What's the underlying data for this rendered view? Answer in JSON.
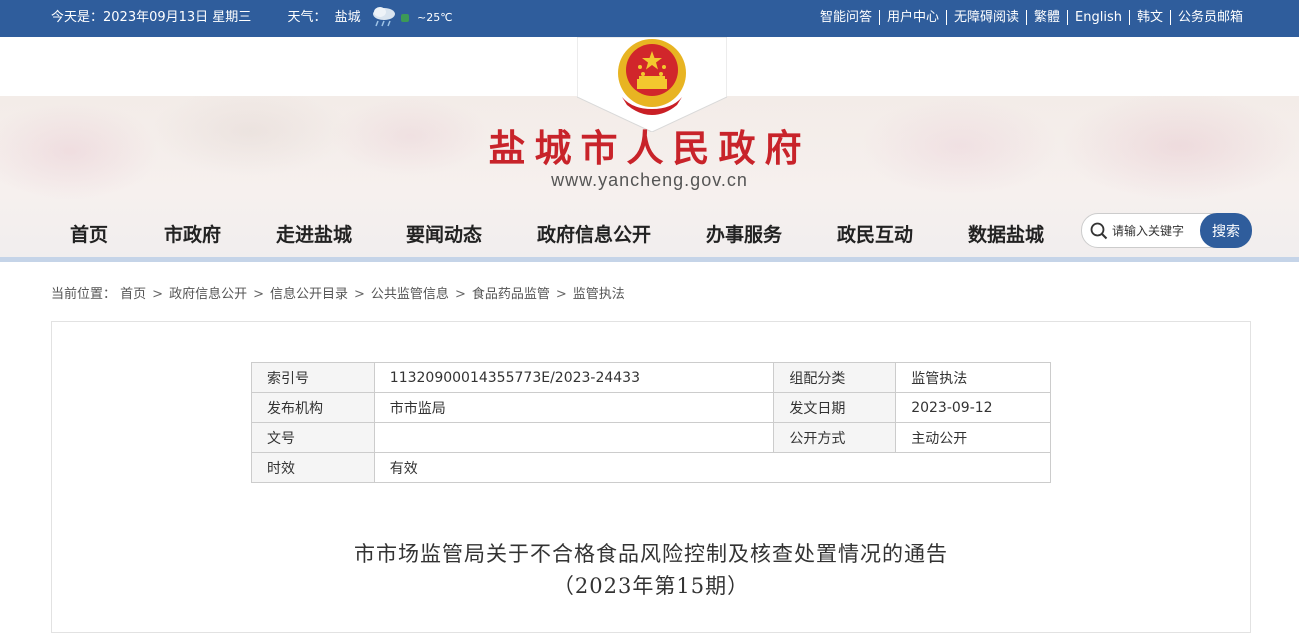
{
  "topbar": {
    "date_text": "今天是：2023年09月13日 星期三",
    "weather_label": "天气：",
    "weather_city": "盐城",
    "weather_temp": "~25℃",
    "links": [
      "智能问答",
      "用户中心",
      "无障碍阅读",
      "繁體",
      "English",
      "韩文",
      "公务员邮箱"
    ]
  },
  "header": {
    "title": "盐城市人民政府",
    "domain": "www.yancheng.gov.cn"
  },
  "nav": {
    "items": [
      "首页",
      "市政府",
      "走进盐城",
      "要闻动态",
      "政府信息公开",
      "办事服务",
      "政民互动",
      "数据盐城"
    ]
  },
  "search": {
    "placeholder": "请输入关键字",
    "button": "搜索"
  },
  "breadcrumb": {
    "label": "当前位置：",
    "items": [
      "首页",
      "政府信息公开",
      "信息公开目录",
      "公共监管信息",
      "食品药品监管",
      "监管执法"
    ]
  },
  "meta": {
    "index_label": "索引号",
    "index_value": "11320900014355773E/2023-24433",
    "category_label": "组配分类",
    "category_value": "监管执法",
    "org_label": "发布机构",
    "org_value": "市市监局",
    "date_label": "发文日期",
    "date_value": "2023-09-12",
    "docno_label": "文号",
    "docno_value": "",
    "open_label": "公开方式",
    "open_value": "主动公开",
    "valid_label": "时效",
    "valid_value": "有效"
  },
  "article": {
    "title": "市市场监管局关于不合格食品风险控制及核查处置情况的通告",
    "subtitle": "（2023年第15期）"
  },
  "colors": {
    "topbar": "#2f5d9c",
    "title_red": "#c8232a",
    "search_button": "#2f5d9c"
  }
}
